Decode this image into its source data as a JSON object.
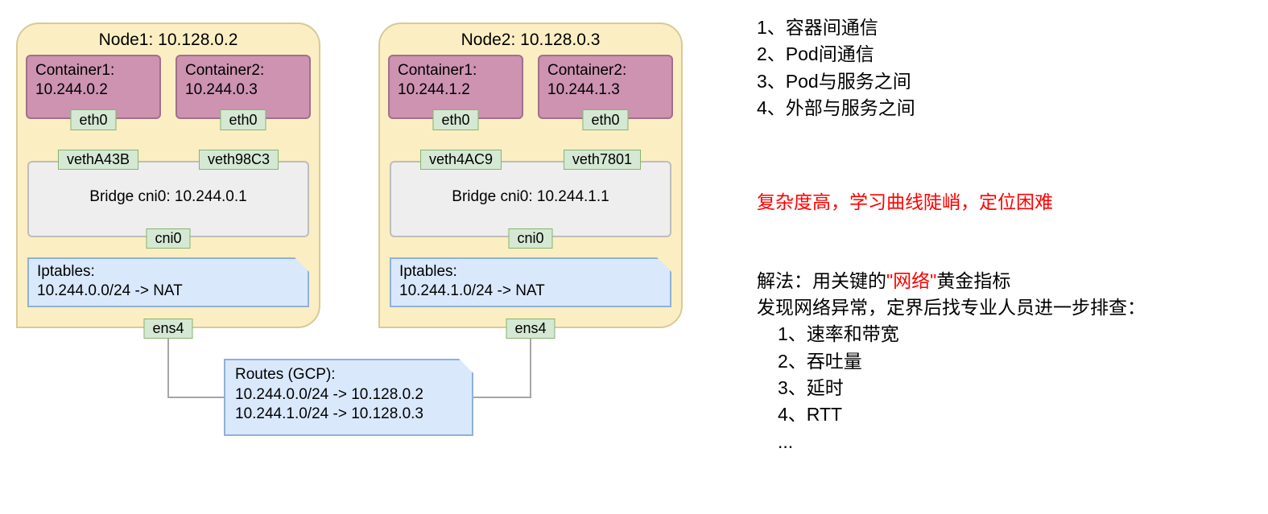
{
  "diagram": {
    "node1": {
      "title": "Node1: 10.128.0.2",
      "container1": {
        "name": "Container1:",
        "ip": "10.244.0.2",
        "iface": "eth0"
      },
      "container2": {
        "name": "Container2:",
        "ip": "10.244.0.3",
        "iface": "eth0"
      },
      "veth_left": "vethA43B",
      "veth_right": "veth98C3",
      "bridge": "Bridge cni0: 10.244.0.1",
      "cni_iface": "cni0",
      "iptables_line1": "Iptables:",
      "iptables_line2": "10.244.0.0/24 -> NAT",
      "ext_iface": "ens4"
    },
    "node2": {
      "title": "Node2: 10.128.0.3",
      "container1": {
        "name": "Container1:",
        "ip": "10.244.1.2",
        "iface": "eth0"
      },
      "container2": {
        "name": "Container2:",
        "ip": "10.244.1.3",
        "iface": "eth0"
      },
      "veth_left": "veth4AC9",
      "veth_right": "veth7801",
      "bridge": "Bridge cni0: 10.244.1.1",
      "cni_iface": "cni0",
      "iptables_line1": "Iptables:",
      "iptables_line2": "10.244.1.0/24 -> NAT",
      "ext_iface": "ens4"
    },
    "routes": {
      "title": "Routes (GCP):",
      "r1": "10.244.0.0/24 -> 10.128.0.2",
      "r2": "10.244.1.0/24 -> 10.128.0.3"
    }
  },
  "notes": {
    "list1": {
      "i1": "1、容器间通信",
      "i2": "2、Pod间通信",
      "i3": "3、Pod与服务之间",
      "i4": "4、外部与服务之间"
    },
    "red_line": "复杂度高，学习曲线陡峭，定位困难",
    "solution_prefix": "解法：用关键的",
    "solution_red": "\"网络\"",
    "solution_suffix": "黄金指标",
    "solution_line2": "发现网络异常，定界后找专业人员进一步排查：",
    "metrics": {
      "m1": "1、速率和带宽",
      "m2": "2、吞吐量",
      "m3": "3、延时",
      "m4": "4、RTT",
      "m5": "..."
    }
  }
}
